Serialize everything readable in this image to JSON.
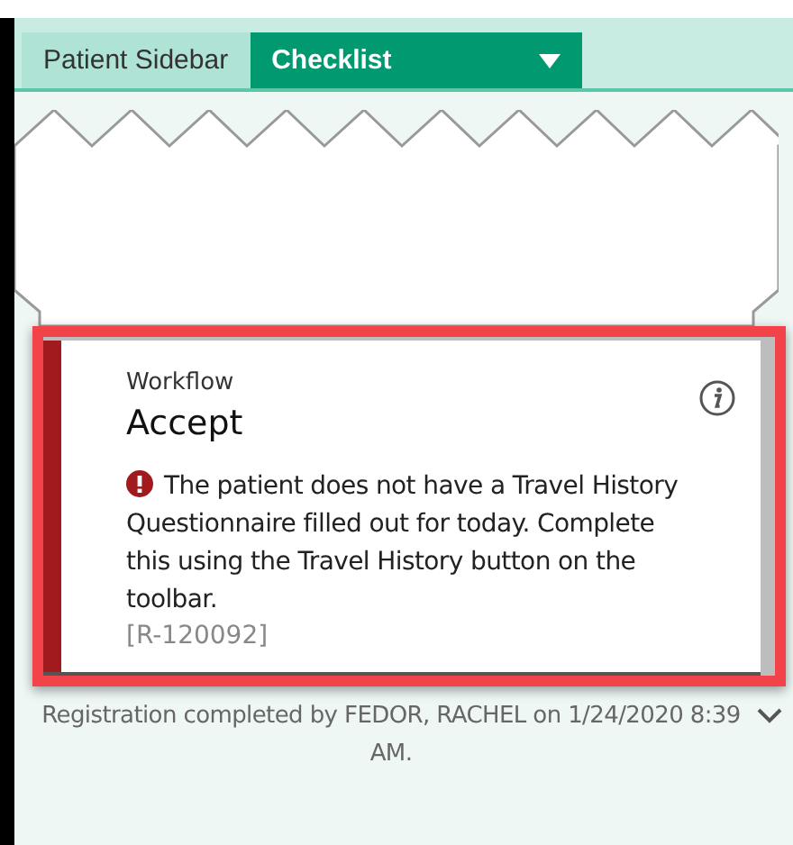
{
  "tabs": [
    {
      "label": "Patient Sidebar",
      "selected": false,
      "dropdown": false
    },
    {
      "label": "Checklist",
      "selected": true,
      "dropdown": true
    }
  ],
  "alert_card": {
    "category": "Workflow",
    "title": "Accept",
    "message": "The patient does not have a Travel History Questionnaire filled out for today. Complete this using the Travel History button on the toolbar.",
    "rule_id": "[R-120092]"
  },
  "footer": "Registration completed by FEDOR, RACHEL on 1/24/2020 8:39 AM."
}
